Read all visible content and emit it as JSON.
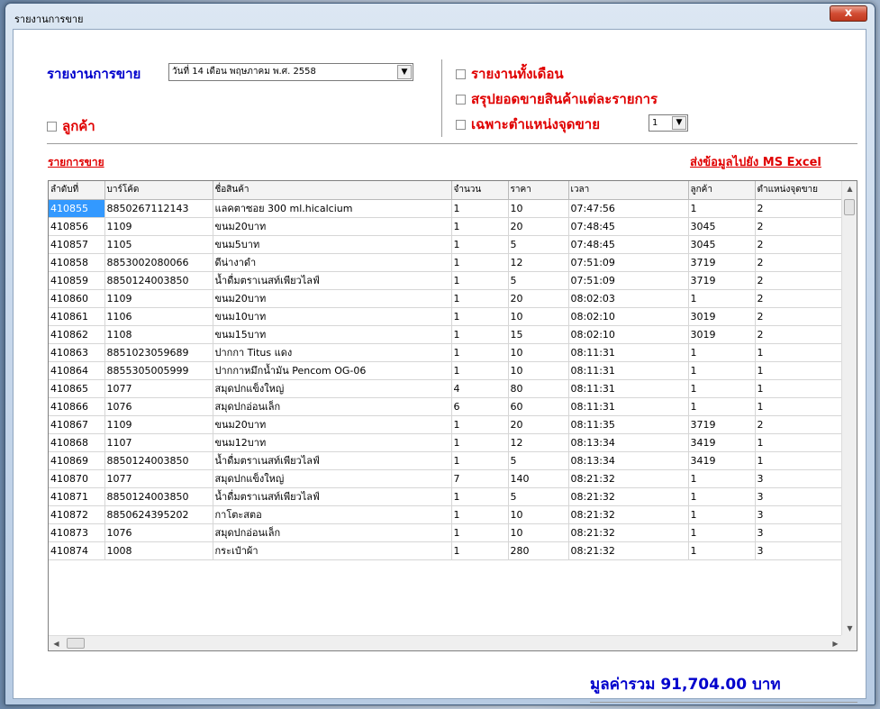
{
  "window": {
    "title": "รายงานการขาย",
    "close_label": "x"
  },
  "header": {
    "report_label": "รายงานการขาย",
    "date_value": "วันที่ 14 เดือน พฤษภาคม พ.ศ. 2558",
    "customer_label": "ลูกค้า",
    "month_report_label": "รายงานทั้งเดือน",
    "summary_label": "สรุปยอดขายสินค้าแต่ละรายการ",
    "pos_only_label": "เฉพาะตำแหน่งจุดขาย",
    "pos_value": "1"
  },
  "links": {
    "items_label": "รายการขาย",
    "export_label": "ส่งข้อมูลไปยัง MS Excel"
  },
  "table": {
    "columns": [
      "ลำดับที่",
      "บาร์โค้ด",
      "ชื่อสินค้า",
      "จำนวน",
      "ราคา",
      "เวลา",
      "ลูกค้า",
      "ตำแหน่งจุดขาย"
    ],
    "rows": [
      [
        "410855",
        "8850267112143",
        "แลคตาซอย 300 ml.hicalcium",
        "1",
        "10",
        "07:47:56",
        "1",
        "2"
      ],
      [
        "410856",
        "1109",
        "ขนม20บาท",
        "1",
        "20",
        "07:48:45",
        "3045",
        "2"
      ],
      [
        "410857",
        "1105",
        "ขนม5บาท",
        "1",
        "5",
        "07:48:45",
        "3045",
        "2"
      ],
      [
        "410858",
        "8853002080066",
        "ดีน่างาดำ",
        "1",
        "12",
        "07:51:09",
        "3719",
        "2"
      ],
      [
        "410859",
        "8850124003850",
        "น้ำดื่มตราเนสท์เพียวไลฟ์",
        "1",
        "5",
        "07:51:09",
        "3719",
        "2"
      ],
      [
        "410860",
        "1109",
        "ขนม20บาท",
        "1",
        "20",
        "08:02:03",
        "1",
        "2"
      ],
      [
        "410861",
        "1106",
        "ขนม10บาท",
        "1",
        "10",
        "08:02:10",
        "3019",
        "2"
      ],
      [
        "410862",
        "1108",
        "ขนม15บาท",
        "1",
        "15",
        "08:02:10",
        "3019",
        "2"
      ],
      [
        "410863",
        "8851023059689",
        "ปากกา Titus แดง",
        "1",
        "10",
        "08:11:31",
        "1",
        "1"
      ],
      [
        "410864",
        "8855305005999",
        "ปากกาหมึกน้ำมัน Pencom OG-06",
        "1",
        "10",
        "08:11:31",
        "1",
        "1"
      ],
      [
        "410865",
        "1077",
        "สมุดปกแข็งใหญ่",
        "4",
        "80",
        "08:11:31",
        "1",
        "1"
      ],
      [
        "410866",
        "1076",
        "สมุดปกอ่อนเล็ก",
        "6",
        "60",
        "08:11:31",
        "1",
        "1"
      ],
      [
        "410867",
        "1109",
        "ขนม20บาท",
        "1",
        "20",
        "08:11:35",
        "3719",
        "2"
      ],
      [
        "410868",
        "1107",
        "ขนม12บาท",
        "1",
        "12",
        "08:13:34",
        "3419",
        "1"
      ],
      [
        "410869",
        "8850124003850",
        "น้ำดื่มตราเนสท์เพียวไลฟ์",
        "1",
        "5",
        "08:13:34",
        "3419",
        "1"
      ],
      [
        "410870",
        "1077",
        "สมุดปกแข็งใหญ่",
        "7",
        "140",
        "08:21:32",
        "1",
        "3"
      ],
      [
        "410871",
        "8850124003850",
        "น้ำดื่มตราเนสท์เพียวไลฟ์",
        "1",
        "5",
        "08:21:32",
        "1",
        "3"
      ],
      [
        "410872",
        "8850624395202",
        "กาโตะสตอ",
        "1",
        "10",
        "08:21:32",
        "1",
        "3"
      ],
      [
        "410873",
        "1076",
        "สมุดปกอ่อนเล็ก",
        "1",
        "10",
        "08:21:32",
        "1",
        "3"
      ],
      [
        "410874",
        "1008",
        "กระเป๋าผ้า",
        "1",
        "280",
        "08:21:32",
        "1",
        "3"
      ]
    ]
  },
  "footer": {
    "total_text": "มูลค่ารวม 91,704.00 บาท"
  },
  "colors": {
    "red": "#e00000",
    "blue": "#0000cc",
    "selection": "#3399ff"
  }
}
